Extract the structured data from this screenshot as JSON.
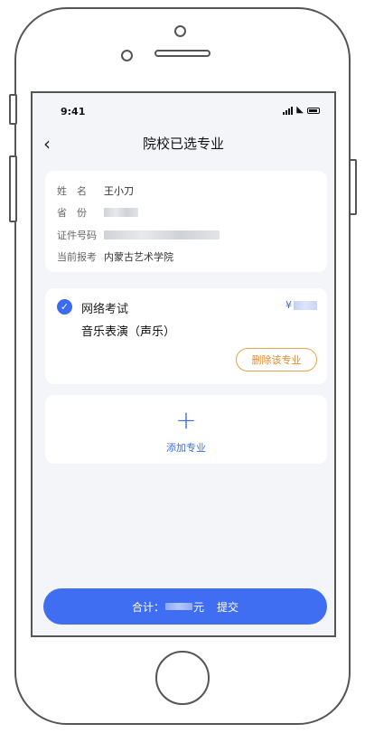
{
  "status_bar": {
    "time": "9:41"
  },
  "nav": {
    "title": "院校已选专业"
  },
  "info": {
    "name_label": "姓　名",
    "name_value": "王小刀",
    "province_label": "省　份",
    "id_label": "证件号码",
    "school_label": "当前报考",
    "school_value": "内蒙古艺术学院"
  },
  "major": {
    "type": "网络考试",
    "currency": "¥",
    "name": "音乐表演（声乐）",
    "delete_label": "删除该专业"
  },
  "add": {
    "label": "添加专业"
  },
  "submit": {
    "total_label": "合计：",
    "unit": "元",
    "submit_label": "提交"
  },
  "colors": {
    "primary": "#3f6ef2",
    "warning": "#e8892b",
    "background": "#f4f5f8"
  }
}
